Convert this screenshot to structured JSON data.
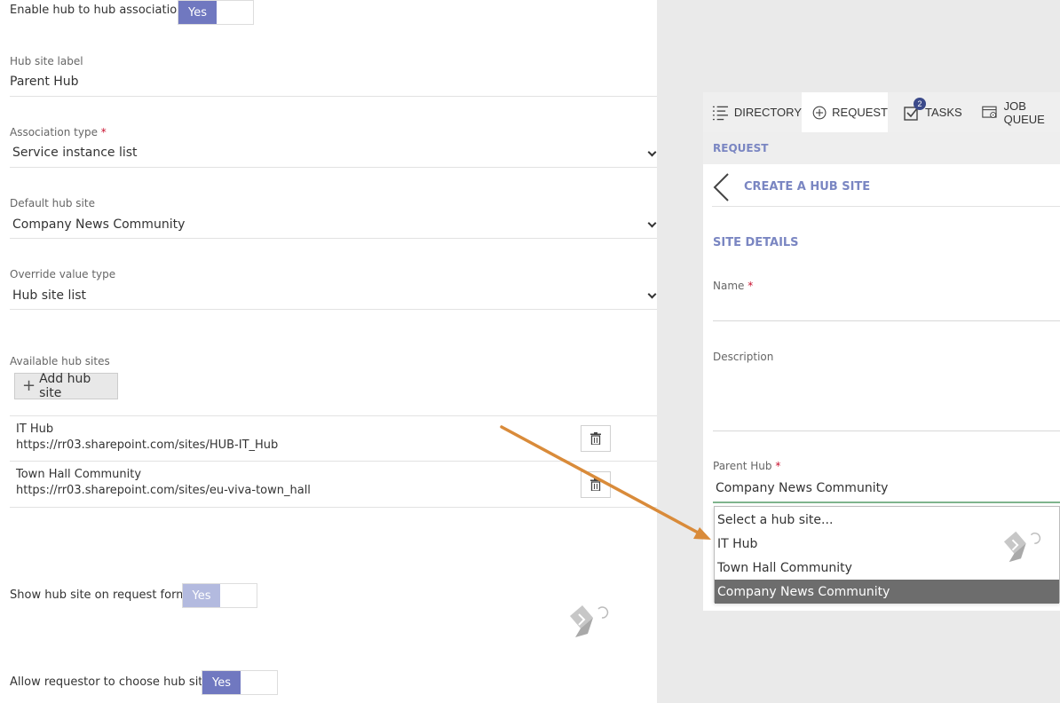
{
  "left": {
    "enable_hub": {
      "label": "Enable hub to hub association",
      "toggle": "Yes"
    },
    "hub_site_label": {
      "label": "Hub site label",
      "value": "Parent Hub"
    },
    "association_type": {
      "label": "Association type",
      "required": "*",
      "value": "Service instance list"
    },
    "default_hub_site": {
      "label": "Default hub site",
      "value": "Company News Community"
    },
    "override_value_type": {
      "label": "Override value type",
      "value": "Hub site list"
    },
    "available_hub_sites": {
      "label": "Available hub sites",
      "add_button": "Add hub site",
      "items": [
        {
          "name": "IT Hub",
          "url": "https://rr03.sharepoint.com/sites/HUB-IT_Hub"
        },
        {
          "name": "Town Hall Community",
          "url": "https://rr03.sharepoint.com/sites/eu-viva-town_hall"
        }
      ]
    },
    "show_hub_site": {
      "label": "Show hub site on request form",
      "toggle": "Yes"
    },
    "allow_choose": {
      "label": "Allow requestor to choose hub site",
      "toggle": "Yes"
    }
  },
  "panel": {
    "tabs": [
      {
        "label": "DIRECTORY",
        "icon": "list-icon"
      },
      {
        "label": "REQUEST",
        "icon": "plus-circle-icon"
      },
      {
        "label": "TASKS",
        "icon": "checkbox-icon",
        "badge": "2"
      },
      {
        "label": "JOB QUEUE",
        "icon": "job-queue-icon"
      }
    ],
    "section": "REQUEST",
    "page_title": "CREATE A HUB SITE",
    "site_details": "SITE DETAILS",
    "name_label": "Name",
    "required": "*",
    "description_label": "Description",
    "parent_hub_label": "Parent Hub",
    "parent_hub_value": "Company News Community",
    "dropdown_options": [
      "Select a hub site...",
      "IT Hub",
      "Town Hall Community",
      "Company News Community"
    ],
    "selected_option": "Company News Community"
  },
  "colors": {
    "toggle_on": "#7078c0",
    "toggle_disabled": "#b3badf",
    "accent_text": "#7a86c2",
    "arrow": "#d98b3a",
    "required": "#c8102e"
  }
}
